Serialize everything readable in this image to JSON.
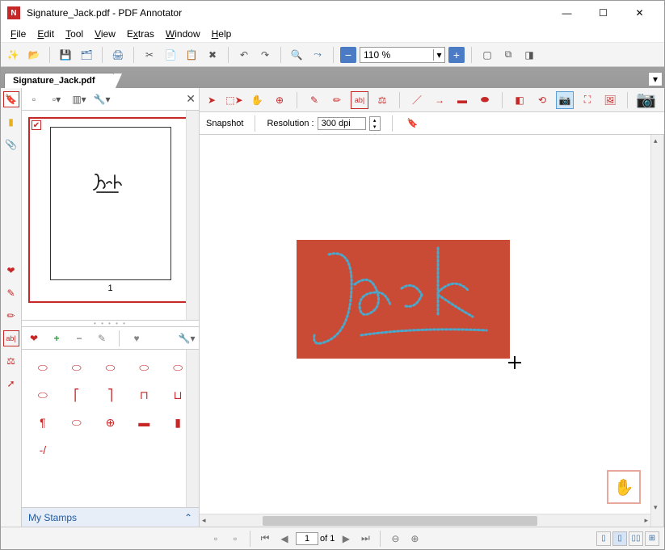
{
  "window": {
    "title": "Signature_Jack.pdf - PDF Annotator",
    "min": "—",
    "max": "☐",
    "close": "✕"
  },
  "menu": {
    "file": "File",
    "edit": "Edit",
    "tool": "Tool",
    "view": "View",
    "extras": "Extras",
    "window": "Window",
    "help": "Help"
  },
  "toolbar": {
    "zoom_value": "110 %"
  },
  "tab": {
    "label": "Signature_Jack.pdf"
  },
  "thumb": {
    "page_num": "1",
    "signature_text": "Jack"
  },
  "stamps": {
    "header": "My Stamps",
    "dash_item": "-/"
  },
  "snapshot": {
    "label": "Snapshot",
    "resolution_label": "Resolution :",
    "resolution_value": "300 dpi"
  },
  "canvas": {
    "signature": "Jack"
  },
  "status": {
    "page_current": "1",
    "page_of_total": "of 1"
  }
}
